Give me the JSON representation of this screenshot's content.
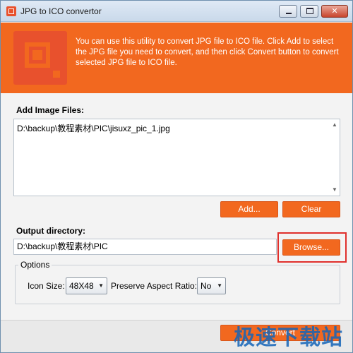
{
  "window": {
    "title": "JPG to ICO convertor",
    "min_glyph": "",
    "max_glyph": "",
    "close_glyph": "✕"
  },
  "banner": {
    "text": "You can use this utility to convert JPG file to ICO file. Click Add to select the JPG file you need to convert, and then click Convert button to convert selected JPG file to ICO file.",
    "color": "#f2681f"
  },
  "add_files": {
    "label": "Add Image Files:",
    "files": [
      "D:\\backup\\教程素材\\PIC\\jisuxz_pic_1.jpg"
    ],
    "add_label": "Add...",
    "clear_label": "Clear"
  },
  "output": {
    "label": "Output directory:",
    "value": "D:\\backup\\教程素材\\PIC",
    "browse_label": "Browse..."
  },
  "options": {
    "legend": "Options",
    "icon_size_label": "Icon Size:",
    "icon_size_value": "48X48",
    "aspect_label": "Preserve Aspect Ratio:",
    "aspect_value": "No"
  },
  "footer": {
    "convert_label": "Convert",
    "watermark": "极速下载站"
  },
  "colors": {
    "accent": "#f2681f",
    "highlight": "#e0302c"
  }
}
